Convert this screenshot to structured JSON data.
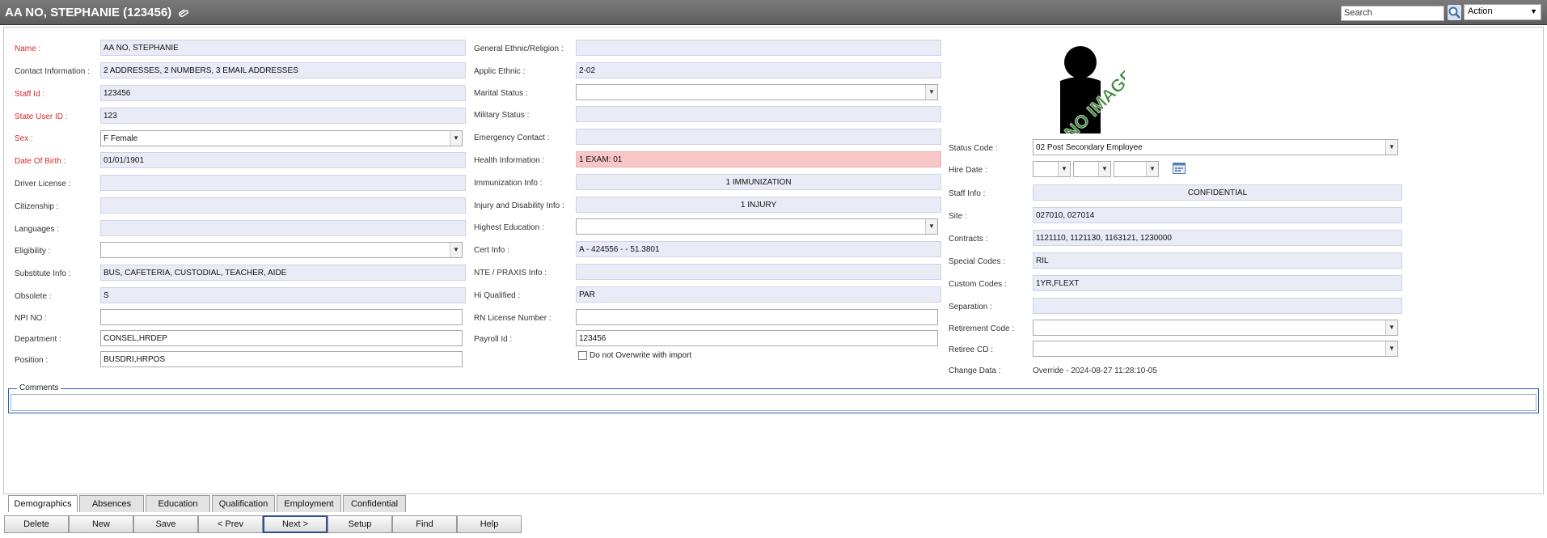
{
  "header": {
    "title": "AA NO, STEPHANIE (123456)",
    "search_placeholder": "Search",
    "action_label": "Action"
  },
  "left": {
    "name": {
      "label": "Name :",
      "value": "AA NO,  STEPHANIE"
    },
    "contact": {
      "label": "Contact Information :",
      "value": "2 ADDRESSES, 2 NUMBERS, 3 EMAIL ADDRESSES"
    },
    "staff_id": {
      "label": "Staff Id :",
      "value": "123456"
    },
    "state_user_id": {
      "label": "State User ID :",
      "value": "123"
    },
    "sex": {
      "label": "Sex :",
      "value": "F Female"
    },
    "dob": {
      "label": "Date Of Birth :",
      "value": "01/01/1901"
    },
    "driver_license": {
      "label": "Driver License :",
      "value": ""
    },
    "citizenship": {
      "label": "Citizenship :",
      "value": ""
    },
    "languages": {
      "label": "Languages :",
      "value": ""
    },
    "eligibility": {
      "label": "Eligibility :",
      "value": ""
    },
    "substitute": {
      "label": "Substitute Info :",
      "value": "BUS, CAFETERIA, CUSTODIAL, TEACHER, AIDE"
    },
    "obsolete": {
      "label": "Obsolete :",
      "value": "S"
    },
    "npi": {
      "label": "NPI NO :",
      "value": ""
    },
    "department": {
      "label": "Department :",
      "value": "CONSEL,HRDEP"
    },
    "position": {
      "label": "Position :",
      "value": "BUSDRI,HRPOS"
    }
  },
  "middle": {
    "ethnic_religion": {
      "label": "General Ethnic/Religion :",
      "value": ""
    },
    "applic_ethnic": {
      "label": "Applic Ethnic :",
      "value": "2-02"
    },
    "marital": {
      "label": "Marital Status :",
      "value": ""
    },
    "military": {
      "label": "Military Status :",
      "value": ""
    },
    "emergency": {
      "label": "Emergency Contact :",
      "value": ""
    },
    "health": {
      "label": "Health Information :",
      "value": "1 EXAM: 01"
    },
    "immunization": {
      "label": "Immunization Info :",
      "value": "1 IMMUNIZATION"
    },
    "injury": {
      "label": "Injury and Disability Info :",
      "value": "1 INJURY"
    },
    "education": {
      "label": "Highest Education :",
      "value": ""
    },
    "cert": {
      "label": "Cert Info :",
      "value": "A - 424556 -  - 51.3801"
    },
    "nte": {
      "label": "NTE / PRAXIS Info :",
      "value": ""
    },
    "hi_qualified": {
      "label": "Hi Qualified :",
      "value": "PAR"
    },
    "rn_license": {
      "label": "RN License Number :",
      "value": ""
    },
    "payroll": {
      "label": "Payroll Id :",
      "value": "123456"
    },
    "no_overwrite": "Do not Overwrite with import"
  },
  "right": {
    "photo_text": "NO IMAGE",
    "status_code": {
      "label": "Status Code :",
      "value": "02 Post Secondary Employee"
    },
    "hire_date": {
      "label": "Hire Date :"
    },
    "staff_info": {
      "label": "Staff Info :",
      "value": "CONFIDENTIAL"
    },
    "site": {
      "label": "Site :",
      "value": "027010, 027014"
    },
    "contracts": {
      "label": "Contracts :",
      "value": "1121110, 1121130, 1163121, 1230000"
    },
    "special_codes": {
      "label": "Special Codes :",
      "value": "RIL"
    },
    "custom_codes": {
      "label": "Custom Codes :",
      "value": "1YR,FLEXT"
    },
    "separation": {
      "label": "Separation :",
      "value": ""
    },
    "retirement_code": {
      "label": "Retirement Code :",
      "value": ""
    },
    "retiree_cd": {
      "label": "Retiree CD :",
      "value": ""
    },
    "change_data": {
      "label": "Change Data :",
      "value": "Override - 2024-08-27 11:28:10-05"
    }
  },
  "comments_label": "Comments",
  "tabs": [
    "Demographics",
    "Absences",
    "Education",
    "Qualification",
    "Employment",
    "Confidential"
  ],
  "buttons": [
    "Delete",
    "New",
    "Save",
    "< Prev",
    "Next >",
    "Setup",
    "Find",
    "Help"
  ],
  "colors": {
    "title_bar": "#6b6b6b",
    "required_label": "#d42b2b",
    "readonly_field": "#e9ebf6",
    "alert_field": "#f8c6c6",
    "no_image_text": "#3f8a3a"
  }
}
